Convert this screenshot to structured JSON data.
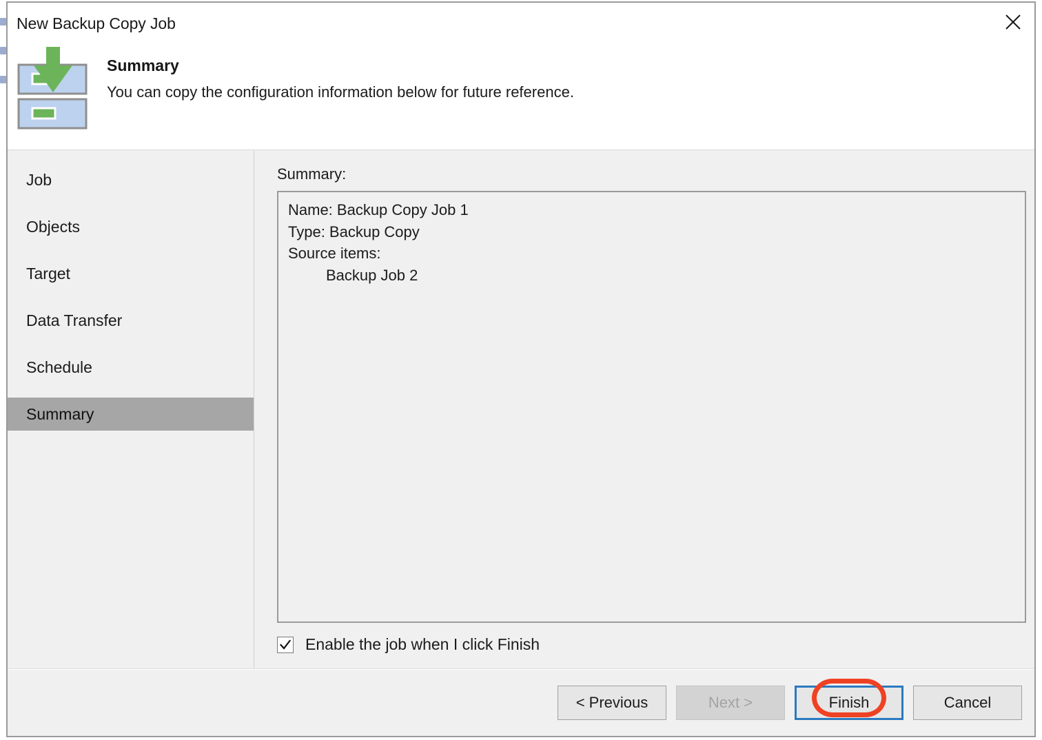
{
  "window": {
    "title": "New Backup Copy Job",
    "close_icon": "close-icon"
  },
  "header": {
    "icon": "backup-copy-download-icon",
    "heading": "Summary",
    "subtitle": "You can copy the configuration information below for future reference."
  },
  "sidebar": {
    "items": [
      {
        "label": "Job",
        "selected": false
      },
      {
        "label": "Objects",
        "selected": false
      },
      {
        "label": "Target",
        "selected": false
      },
      {
        "label": "Data Transfer",
        "selected": false
      },
      {
        "label": "Schedule",
        "selected": false
      },
      {
        "label": "Summary",
        "selected": true
      }
    ]
  },
  "content": {
    "summary_label": "Summary:",
    "summary_text": "Name: Backup Copy Job 1\nType: Backup Copy\nSource items:\n         Backup Job 2",
    "checkbox": {
      "label": "Enable the job when I click Finish",
      "checked": true,
      "check_glyph": "✓"
    }
  },
  "footer": {
    "buttons": [
      {
        "label": "< Previous",
        "state": "enabled"
      },
      {
        "label": "Next >",
        "state": "disabled"
      },
      {
        "label": "Finish",
        "state": "default"
      },
      {
        "label": "Cancel",
        "state": "enabled"
      }
    ]
  },
  "annotation": {
    "shape": "ellipse",
    "color": "#ef4123",
    "target": "Finish"
  },
  "colors": {
    "dialog_background": "#f0f0f0",
    "header_background": "#ffffff",
    "selected_nav": "#a6a6a6",
    "focus_border": "#2a7ac0",
    "annotation_red": "#ef4123",
    "icon_green": "#6cb45a",
    "icon_blue": "#bcd2ee"
  }
}
